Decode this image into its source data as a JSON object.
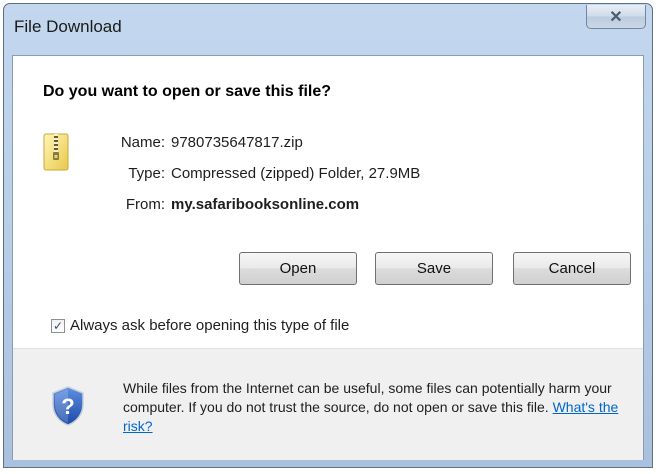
{
  "window": {
    "title": "File Download",
    "close_glyph": "✕"
  },
  "dialog": {
    "question": "Do you want to open or save this file?",
    "file_icon": "zip-folder-icon",
    "fields": {
      "name_label": "Name:",
      "name_value": "9780735647817.zip",
      "type_label": "Type:",
      "type_value": "Compressed (zipped) Folder, 27.9MB",
      "from_label": "From:",
      "from_value": "my.safaribooksonline.com"
    },
    "buttons": {
      "open": "Open",
      "save": "Save",
      "cancel": "Cancel"
    },
    "checkbox": {
      "label": "Always ask before opening this type of file",
      "checked": true,
      "check_glyph": "✓"
    },
    "warning": {
      "icon": "shield-question-icon",
      "text": "While files from the Internet can be useful, some files can potentially harm your computer. If you do not trust the source, do not open or save this file.",
      "link": "What's the risk?"
    }
  }
}
